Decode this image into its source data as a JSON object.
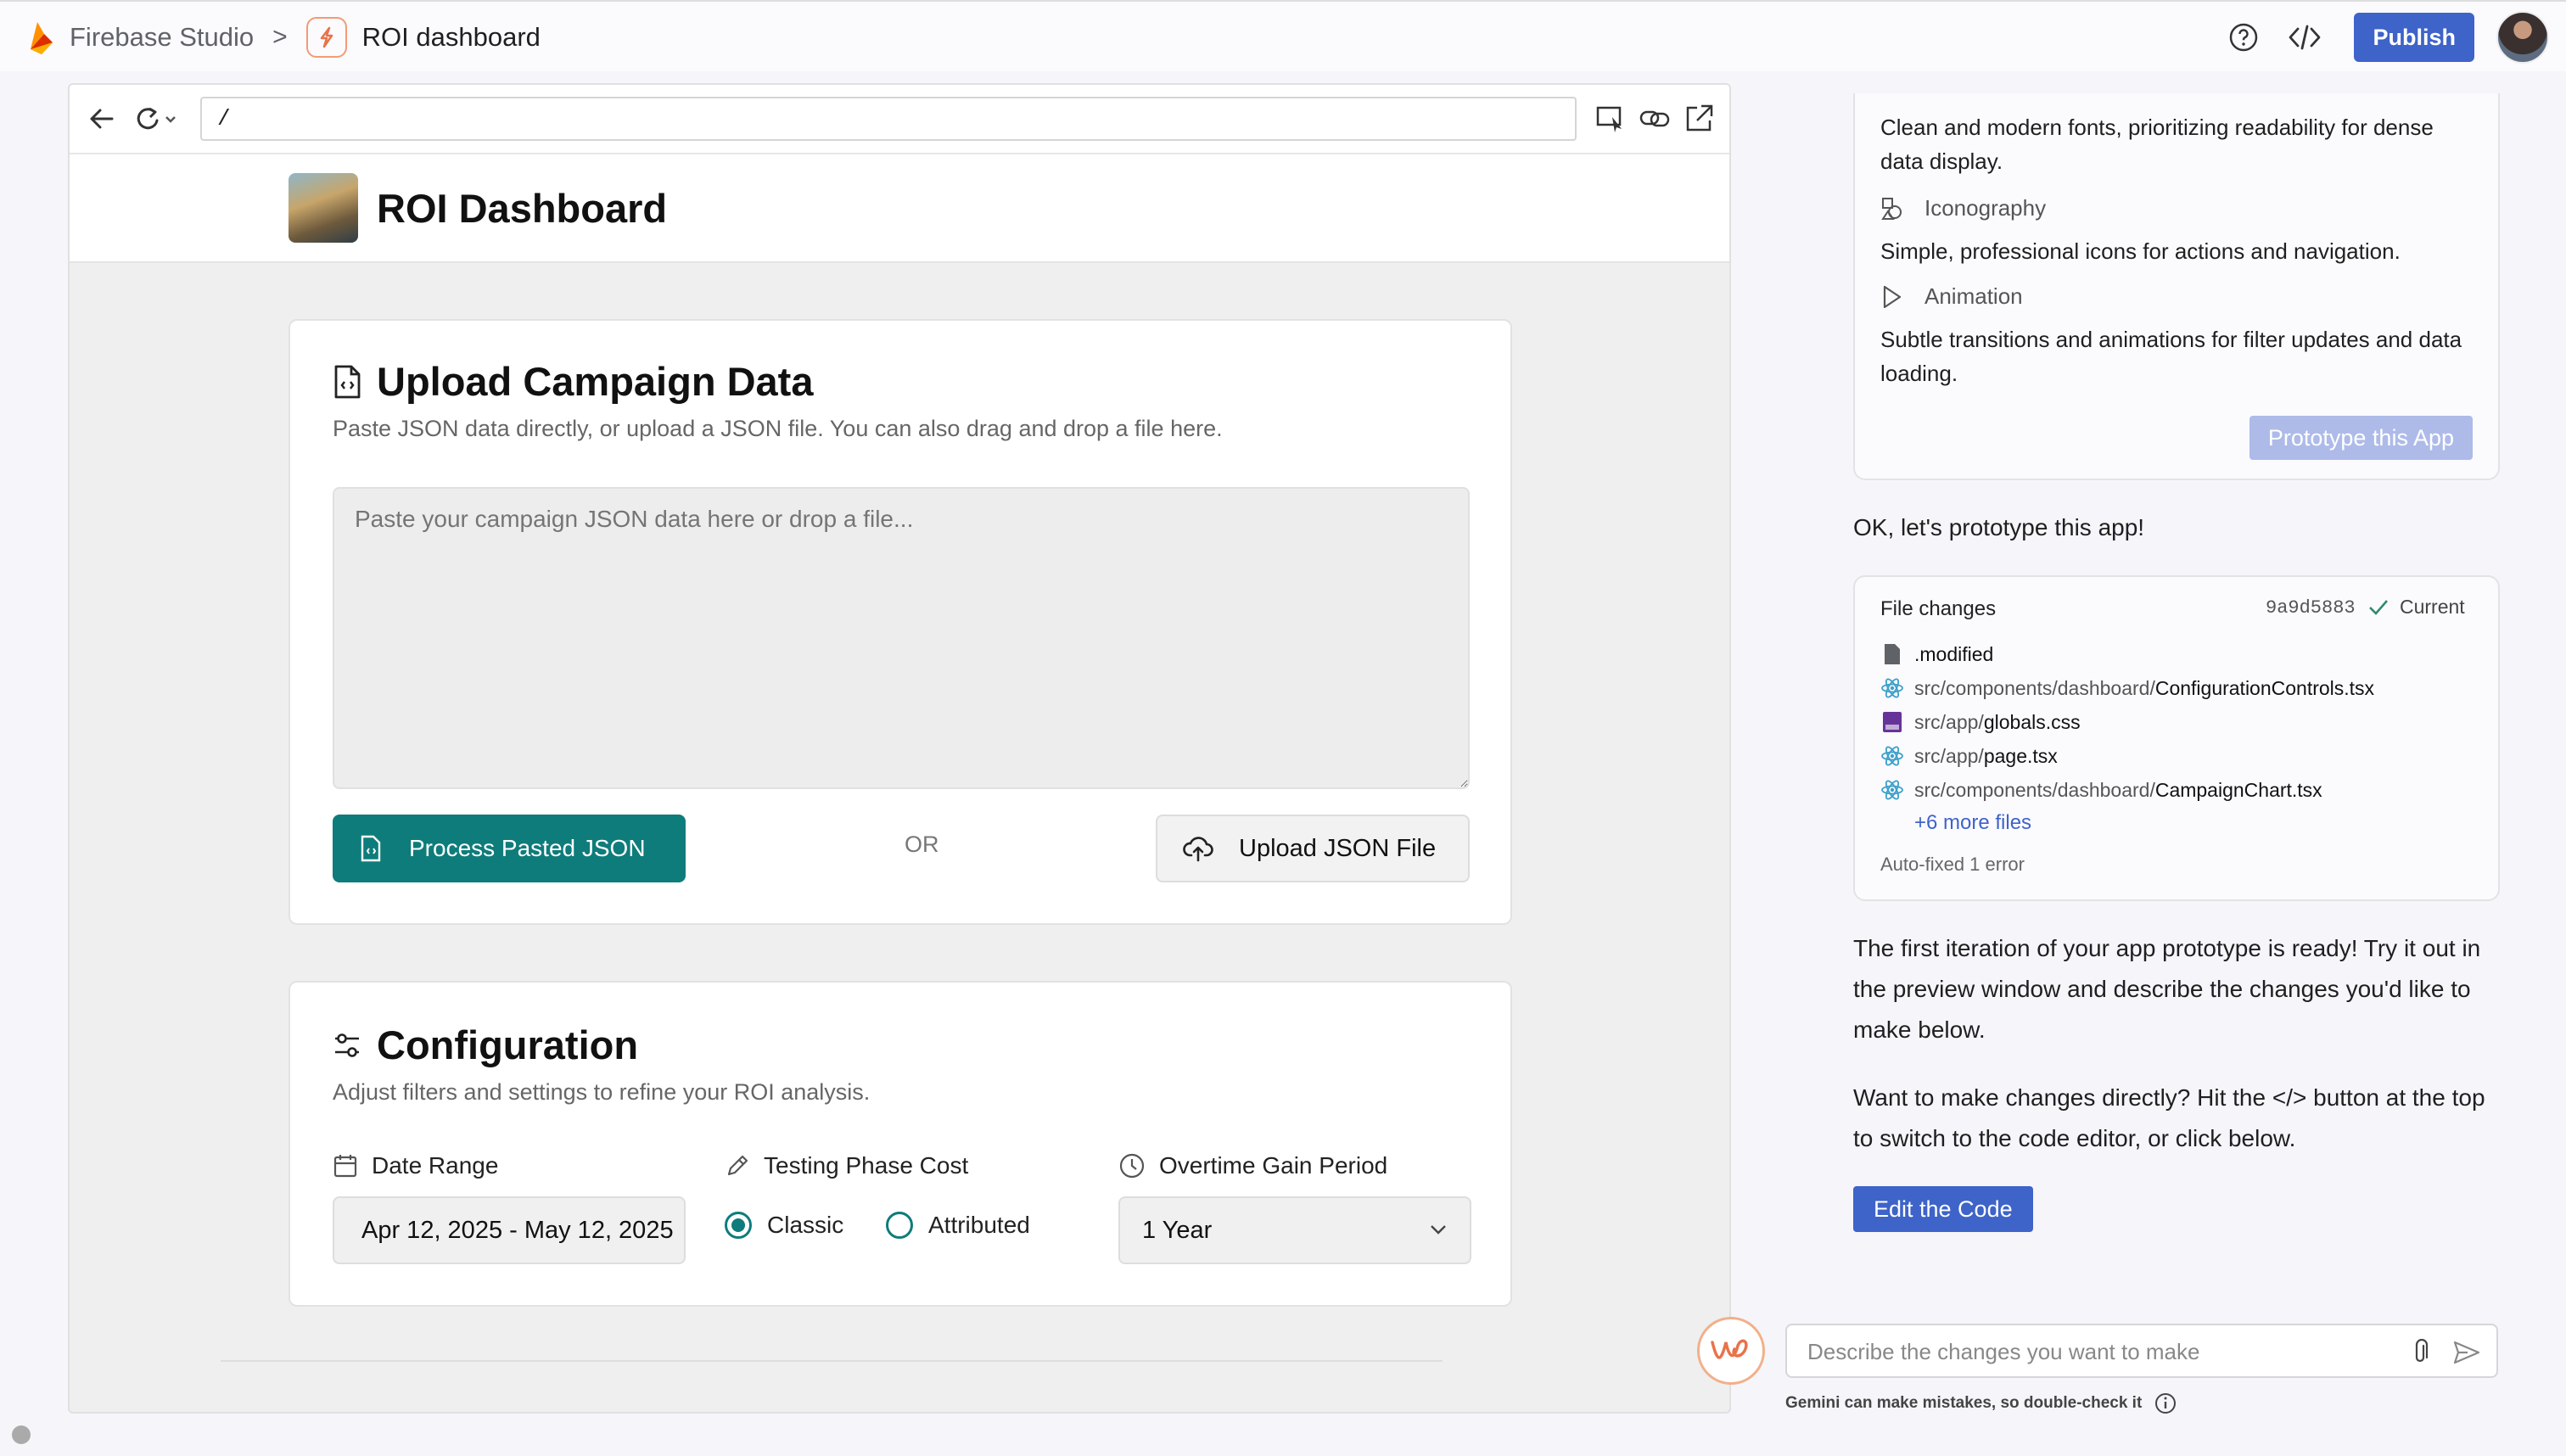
{
  "topbar": {
    "app_name": "Firebase Studio",
    "separator": ">",
    "project_name": "ROI dashboard",
    "publish_label": "Publish"
  },
  "preview": {
    "url": "/",
    "app_title": "ROI Dashboard",
    "upload_card": {
      "title": "Upload Campaign Data",
      "subtitle": "Paste JSON data directly, or upload a JSON file. You can also drag and drop a file here.",
      "textarea_placeholder": "Paste your campaign JSON data here or drop a file...",
      "process_label": "Process Pasted JSON",
      "or_label": "OR",
      "upload_label": "Upload JSON File"
    },
    "config_card": {
      "title": "Configuration",
      "subtitle": "Adjust filters and settings to refine your ROI analysis.",
      "date_range_label": "Date Range",
      "date_range_value": "Apr 12, 2025 - May 12, 2025",
      "testing_cost_label": "Testing Phase Cost",
      "radio_classic": "Classic",
      "radio_attributed": "Attributed",
      "radio_selected": "Classic",
      "overtime_label": "Overtime Gain Period",
      "overtime_value": "1 Year"
    }
  },
  "chat": {
    "feature_card": {
      "typography_text": "Clean and modern fonts, prioritizing readability for dense data display.",
      "iconography_heading": "Iconography",
      "iconography_text": "Simple, professional icons for actions and navigation.",
      "animation_heading": "Animation",
      "animation_text": "Subtle transitions and animations for filter updates and data loading.",
      "prototype_button": "Prototype this App"
    },
    "msg_ok": "OK, let's prototype this app!",
    "file_changes": {
      "title": "File changes",
      "hash": "9a9d5883",
      "status": "Current",
      "files": [
        {
          "dir": "",
          "name": ".modified",
          "icon": "file-icon"
        },
        {
          "dir": "src/components/dashboard/",
          "name": "ConfigurationControls.tsx",
          "icon": "react-icon"
        },
        {
          "dir": "src/app/",
          "name": "globals.css",
          "icon": "css-icon"
        },
        {
          "dir": "src/app/",
          "name": "page.tsx",
          "icon": "react-icon"
        },
        {
          "dir": "src/components/dashboard/",
          "name": "CampaignChart.tsx",
          "icon": "react-icon"
        }
      ],
      "more_files": "+6 more files",
      "auto_fixed": "Auto-fixed 1 error"
    },
    "msg_ready": "The first iteration of your app prototype is ready! Try it out in the preview window and describe the changes you'd like to make below.",
    "msg_code_before": "Want to make changes directly? Hit the",
    "msg_code_symbol": "</>",
    "msg_code_after": "button at the top to switch to the code editor, or click below.",
    "edit_button": "Edit the Code",
    "input_placeholder": "Describe the changes you want to make",
    "disclaimer": "Gemini can make mistakes, so double-check it"
  },
  "colors": {
    "accent_blue": "#3e63c9",
    "teal": "#0e7c7b",
    "prototype_disabled": "#aebbe9"
  }
}
